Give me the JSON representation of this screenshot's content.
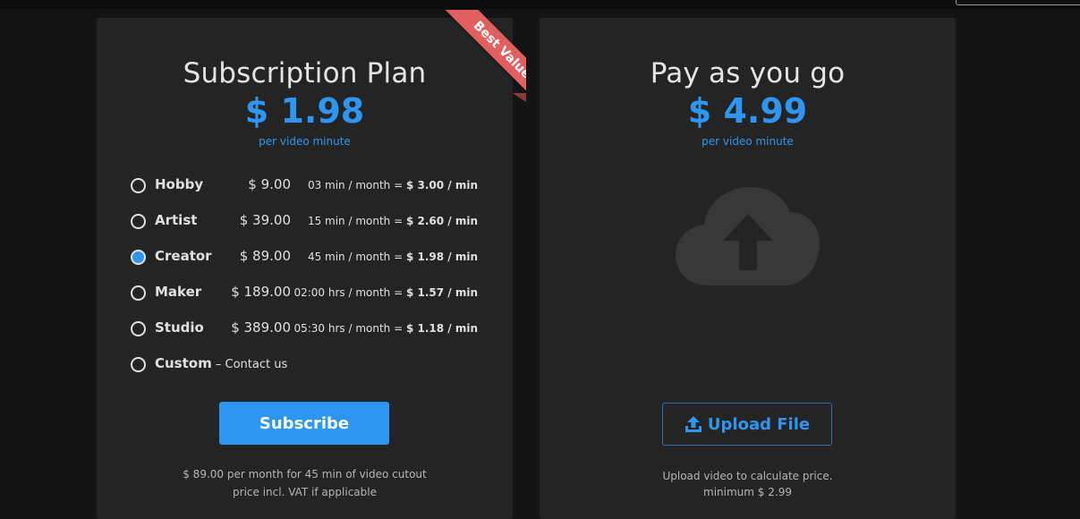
{
  "subscription": {
    "title": "Subscription Plan",
    "ribbon": "Best Value",
    "price": "$ 1.98",
    "price_unit": "per video minute",
    "plans": [
      {
        "name": "Hobby",
        "price": "$ 9.00",
        "rate_prefix": "03 min / month = ",
        "rate_value": "$ 3.00 / min",
        "selected": false
      },
      {
        "name": "Artist",
        "price": "$ 39.00",
        "rate_prefix": "15 min / month = ",
        "rate_value": "$ 2.60 / min",
        "selected": false
      },
      {
        "name": "Creator",
        "price": "$ 89.00",
        "rate_prefix": "45 min / month = ",
        "rate_value": "$ 1.98 / min",
        "selected": true
      },
      {
        "name": "Maker",
        "price": "$ 189.00",
        "rate_prefix": "02:00 hrs / month = ",
        "rate_value": "$ 1.57 / min",
        "selected": false
      },
      {
        "name": "Studio",
        "price": "$ 389.00",
        "rate_prefix": "05:30 hrs / month = ",
        "rate_value": "$ 1.18 / min",
        "selected": false
      }
    ],
    "custom": {
      "name": "Custom",
      "suffix": " – Contact us",
      "selected": false
    },
    "button_label": "Subscribe",
    "note_line1": "$ 89.00 per month for 45 min of video cutout",
    "note_line2": "price incl. VAT if applicable"
  },
  "payg": {
    "title": "Pay as you go",
    "price": "$ 4.99",
    "price_unit": "per video minute",
    "cloud_icon": "cloud-upload-icon",
    "button_label": "Upload File",
    "button_icon": "upload-icon",
    "note_line1": "Upload video to calculate price.",
    "note_line2": "minimum $ 2.99"
  },
  "colors": {
    "accent": "#2e96f0",
    "ribbon": "#e25f5f",
    "card": "#242424",
    "background": "#141414"
  }
}
